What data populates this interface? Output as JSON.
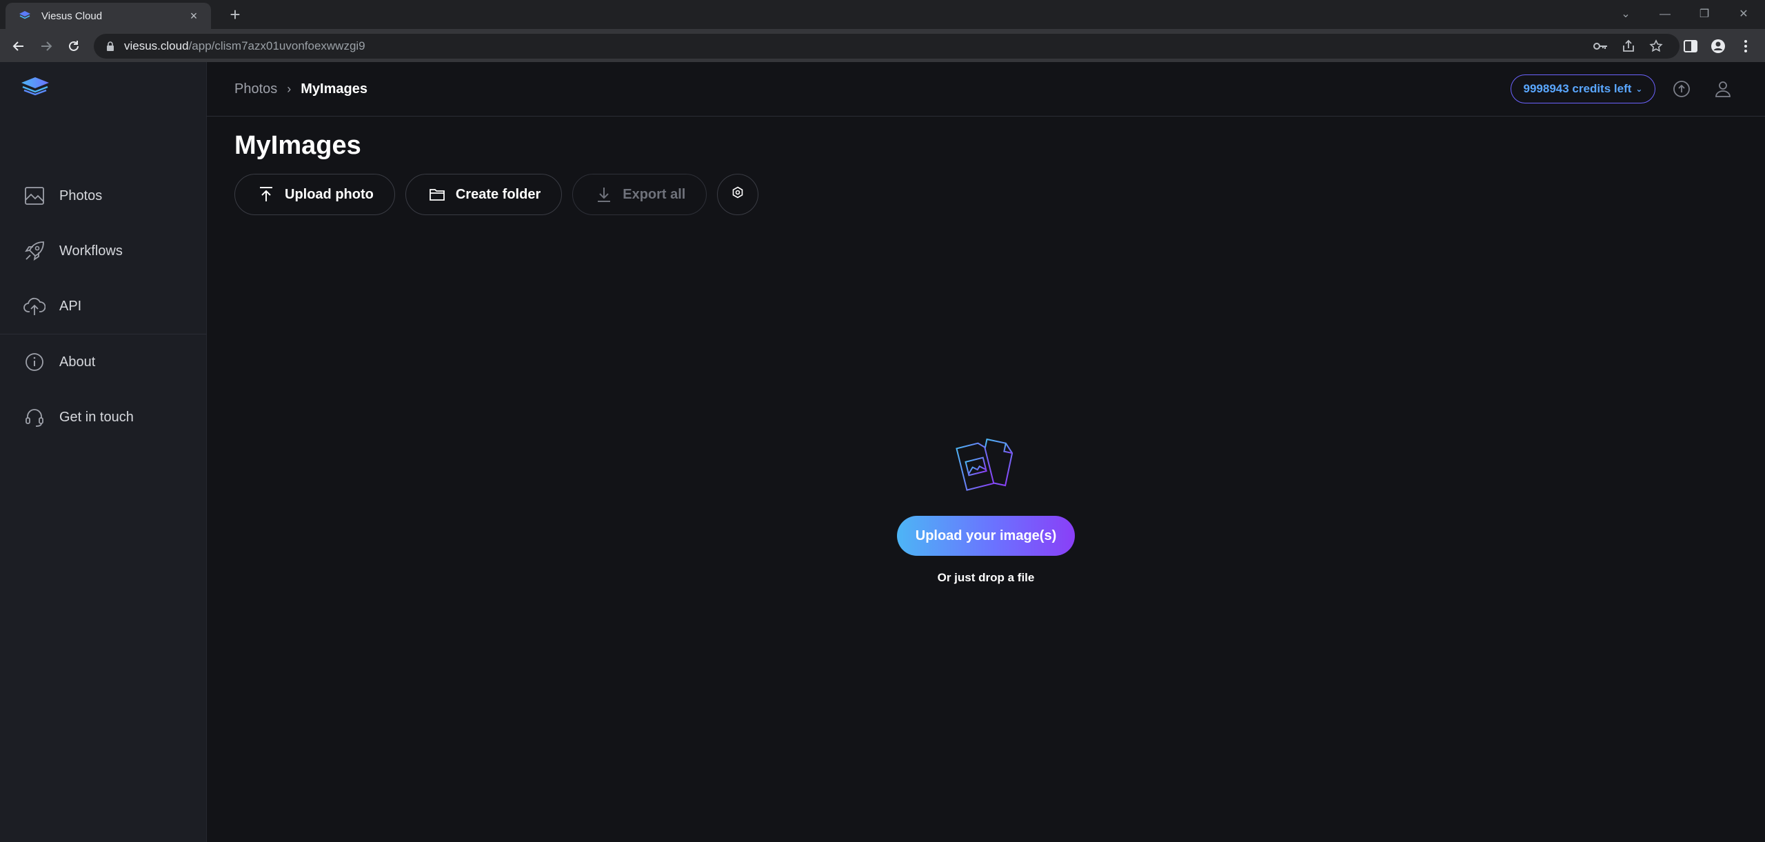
{
  "browser": {
    "tab_title": "Viesus Cloud",
    "new_tab": "+",
    "url_host": "viesus.cloud",
    "url_path": "/app/clism7azx01uvonfoexwwzgi9"
  },
  "sidebar": {
    "items": [
      {
        "label": "Photos",
        "icon": "image-icon"
      },
      {
        "label": "Workflows",
        "icon": "rocket-icon"
      },
      {
        "label": "API",
        "icon": "cloud-upload-icon"
      },
      {
        "label": "About",
        "icon": "info-icon"
      },
      {
        "label": "Get in touch",
        "icon": "headset-icon"
      }
    ]
  },
  "header": {
    "breadcrumb": {
      "parent": "Photos",
      "separator": "›",
      "current": "MyImages"
    },
    "credits_label": "9998943 credits left"
  },
  "main": {
    "title": "MyImages",
    "actions": {
      "upload_photo": "Upload photo",
      "create_folder": "Create folder",
      "export_all": "Export all"
    },
    "empty_state": {
      "cta": "Upload your image(s)",
      "hint": "Or just drop a file"
    }
  },
  "colors": {
    "accent_gradient_start": "#4db5f5",
    "accent_gradient_end": "#8a3ff7",
    "credits_border": "#6c63ff",
    "background": "#121317",
    "sidebar": "#1c1e24"
  }
}
